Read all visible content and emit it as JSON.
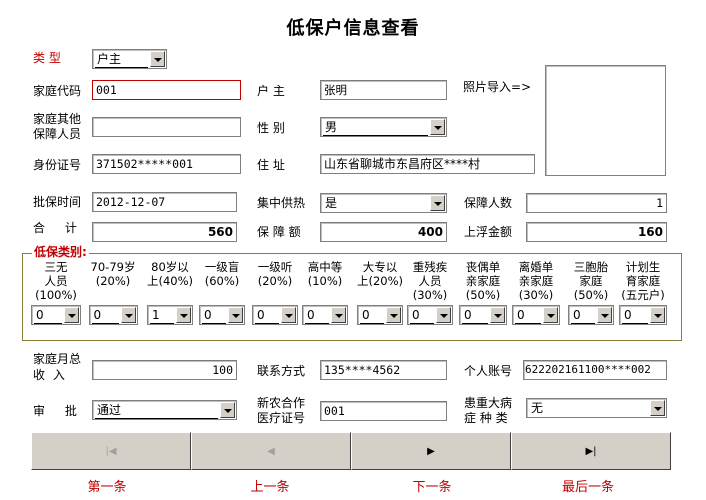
{
  "title": "低保户信息查看",
  "fields": {
    "type_label": "类 型",
    "type_value": "户主",
    "family_code_label": "家庭代码",
    "family_code_value": "001",
    "householder_label": "户 主",
    "householder_value": "张明",
    "photo_label": "照片导入=>",
    "other_members_label_1": "家庭其他",
    "other_members_label_2": "保障人员",
    "other_members_value": "",
    "gender_label": "性 别",
    "gender_value": "男",
    "id_label": "身份证号",
    "id_value": "371502*****001",
    "address_label": "住 址",
    "address_value": "山东省聊城市东昌府区****村",
    "approve_time_label": "批保时间",
    "approve_time_value": "2012-12-07",
    "heating_label": "集中供热",
    "heating_value": "是",
    "protected_count_label": "保障人数",
    "protected_count_value": "1",
    "total_label": "合 计",
    "total_value": "560",
    "amount_label": "保 障 额",
    "amount_value": "400",
    "float_label": "上浮金额",
    "float_value": "160"
  },
  "categories": {
    "title": "低保类别:",
    "items": [
      {
        "lines": [
          "三无",
          "人员",
          "(100%)"
        ],
        "value": "0"
      },
      {
        "lines": [
          "70-79岁",
          "(20%)"
        ],
        "value": "0"
      },
      {
        "lines": [
          "80岁以",
          "上(40%)"
        ],
        "value": "1"
      },
      {
        "lines": [
          "一级盲",
          "(60%)"
        ],
        "value": "0"
      },
      {
        "lines": [
          "一级听",
          "(20%)"
        ],
        "value": "0"
      },
      {
        "lines": [
          "高中等",
          "(10%)"
        ],
        "value": "0"
      },
      {
        "lines": [
          "大专以",
          "上(20%)"
        ],
        "value": "0"
      },
      {
        "lines": [
          "重残疾",
          "人员",
          "(30%)"
        ],
        "value": "0"
      },
      {
        "lines": [
          "丧偶单",
          "亲家庭",
          "(50%)"
        ],
        "value": "0"
      },
      {
        "lines": [
          "离婚单",
          "亲家庭",
          "(30%)"
        ],
        "value": "0"
      },
      {
        "lines": [
          "三胞胎",
          "家庭",
          "(50%)"
        ],
        "value": "0"
      },
      {
        "lines": [
          "计划生",
          "育家庭",
          "(五元户)"
        ],
        "value": "0"
      }
    ]
  },
  "bottom": {
    "income_label_1": "家庭月总",
    "income_label_2": "收 入",
    "income_value": "100",
    "contact_label": "联系方式",
    "contact_value": "135****4562",
    "account_label": "个人账号",
    "account_value": "622202161100****002",
    "approval_label": "审 批",
    "approval_value": "通过",
    "coop_label_1": "新农合作",
    "coop_label_2": "医疗证号",
    "coop_value": "001",
    "illness_label_1": "患重大病",
    "illness_label_2": "症 种 类",
    "illness_value": "无"
  },
  "nav": {
    "first": "第一条",
    "prev": "上一条",
    "next": "下一条",
    "last": "最后一条"
  }
}
